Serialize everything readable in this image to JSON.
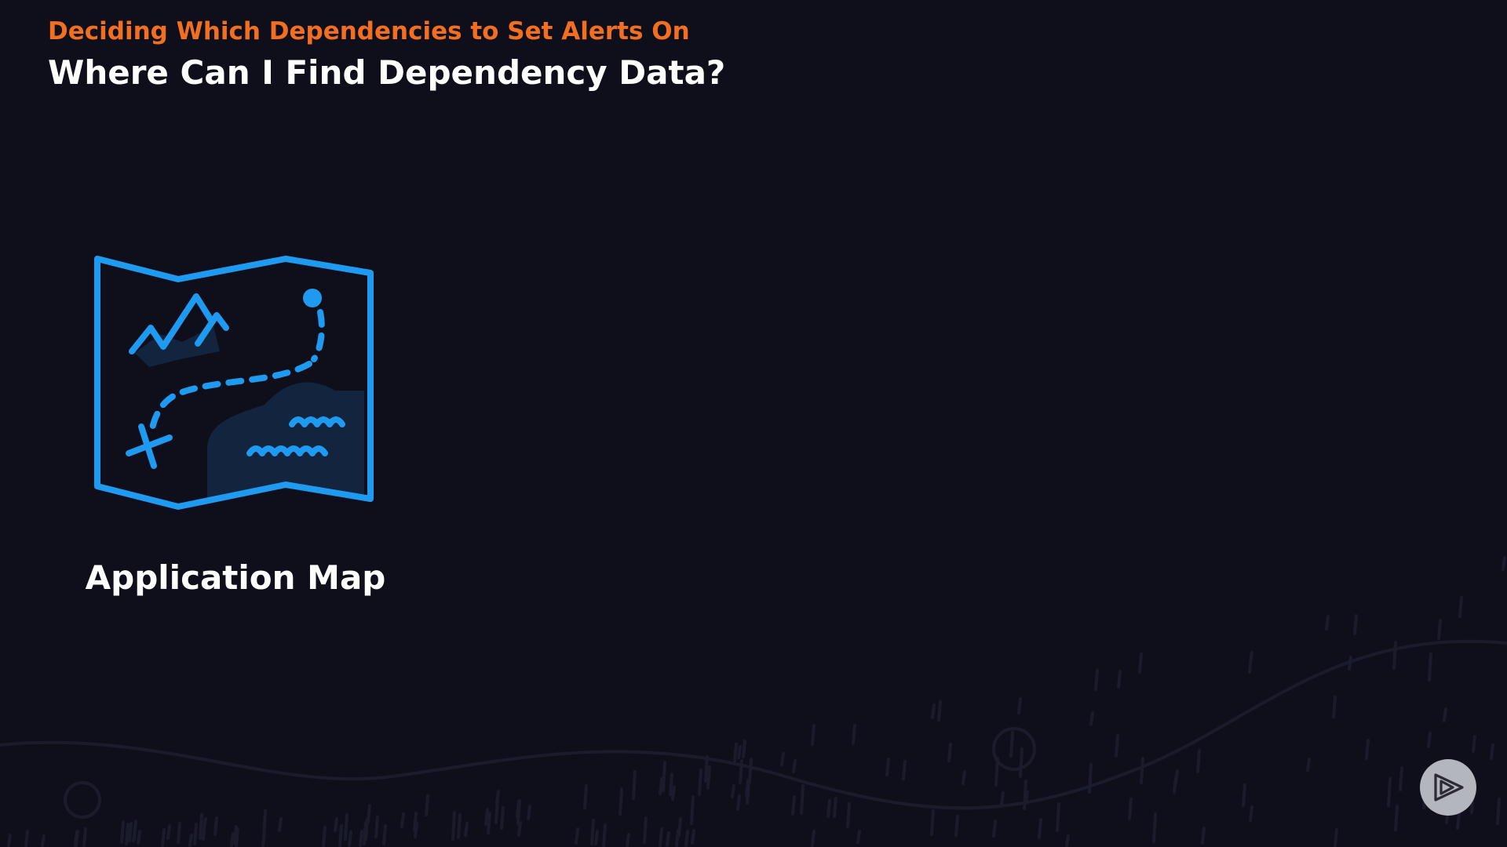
{
  "header": {
    "subtitle": "Deciding Which Dependencies to Set Alerts On",
    "title": "Where Can I Find Dependency Data?"
  },
  "content": {
    "icon": "map-icon",
    "label": "Application Map"
  },
  "controls": {
    "play_icon": "pluralsight-play-icon"
  },
  "colors": {
    "background": "#0f0f1c",
    "accent_orange": "#f26f22",
    "icon_blue": "#1e9bf0",
    "text_white": "#ffffff"
  }
}
